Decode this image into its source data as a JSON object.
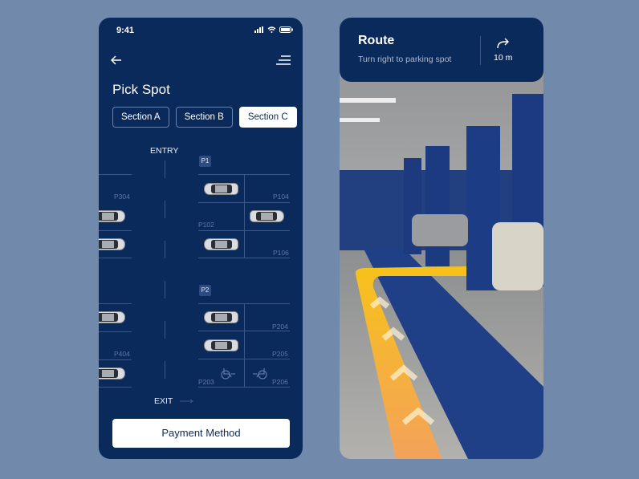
{
  "status": {
    "time": "9:41"
  },
  "pick": {
    "title": "Pick Spot",
    "tabs": [
      {
        "label": "Section A"
      },
      {
        "label": "Section B"
      },
      {
        "label": "Section C",
        "active": true
      }
    ],
    "map": {
      "entry": "ENTRY",
      "exit": "EXIT",
      "zones": [
        "P1",
        "P2"
      ],
      "spots": [
        "P304",
        "P104",
        "P102",
        "P106",
        "P204",
        "P404",
        "P205",
        "P203",
        "P206"
      ]
    },
    "payment_label": "Payment Method"
  },
  "route": {
    "title": "Route",
    "instruction": "Turn right to parking spot",
    "distance": "10 m",
    "icon": "turn-right-icon"
  },
  "colors": {
    "primary": "#0b2a5c",
    "background": "#7189ab",
    "route": "#f5b51c"
  }
}
